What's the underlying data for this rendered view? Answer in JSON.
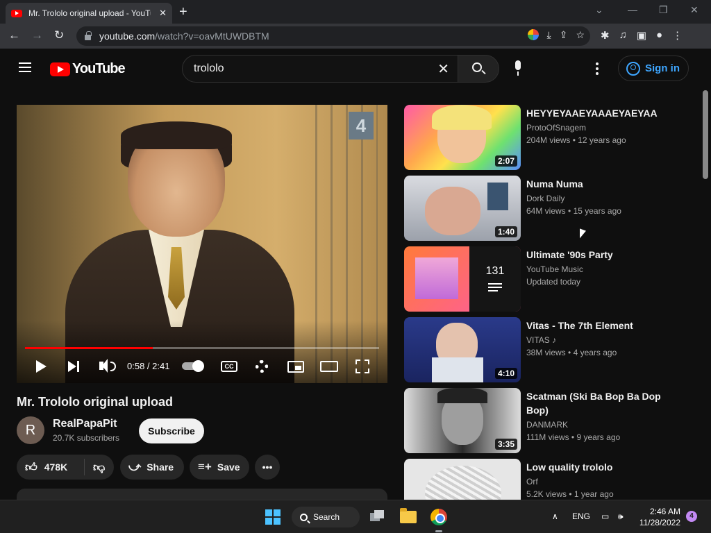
{
  "browser": {
    "tab_title": "Mr. Trololo original upload - YouTube",
    "url_host": "youtube.com",
    "url_path": "/watch?v=oavMtUWDBTM"
  },
  "youtube": {
    "logo_text": "YouTube",
    "search_query": "trololo",
    "signin_label": "Sign in"
  },
  "player": {
    "time_current": "0:58",
    "time_total": "2:41",
    "progress": 0.36,
    "cc_label": "CC"
  },
  "video": {
    "title": "Mr. Trololo original upload",
    "channel_initial": "R",
    "channel": "RealPapaPit",
    "subscribers": "20.7K subscribers",
    "subscribe_label": "Subscribe",
    "likes": "478K",
    "share_label": "Share",
    "save_label": "Save"
  },
  "recommendations": [
    {
      "title": "HEYYEYAAEYAAAEYAEYAA",
      "channel": "ProtoOfSnagem",
      "views": "204M views",
      "age": "12 years ago",
      "duration": "2:07"
    },
    {
      "title": "Numa Numa",
      "channel": "Dork Daily",
      "views": "64M views",
      "age": "15 years ago",
      "duration": "1:40"
    },
    {
      "title": "Ultimate '90s Party",
      "channel": "YouTube Music",
      "views": "Updated today",
      "playlist_count": "131"
    },
    {
      "title": "Vitas - The 7th Element",
      "channel": "VITAS",
      "views": "38M views",
      "age": "4 years ago",
      "duration": "4:10"
    },
    {
      "title": "Scatman (Ski Ba Bop Ba Dop Bop)",
      "channel": "DANMARK",
      "views": "111M views",
      "age": "9 years ago",
      "duration": "3:35"
    },
    {
      "title": "Low quality trololo",
      "channel": "Orf",
      "views": "5.2K views",
      "age": "1 year ago"
    }
  ],
  "taskbar": {
    "search_label": "Search",
    "language": "ENG",
    "time": "2:46 AM",
    "date": "11/28/2022",
    "notification_count": "4"
  },
  "colors": {
    "background": "#0f0f0f",
    "accent_red": "#ff0000",
    "link_blue": "#3ea6ff"
  }
}
